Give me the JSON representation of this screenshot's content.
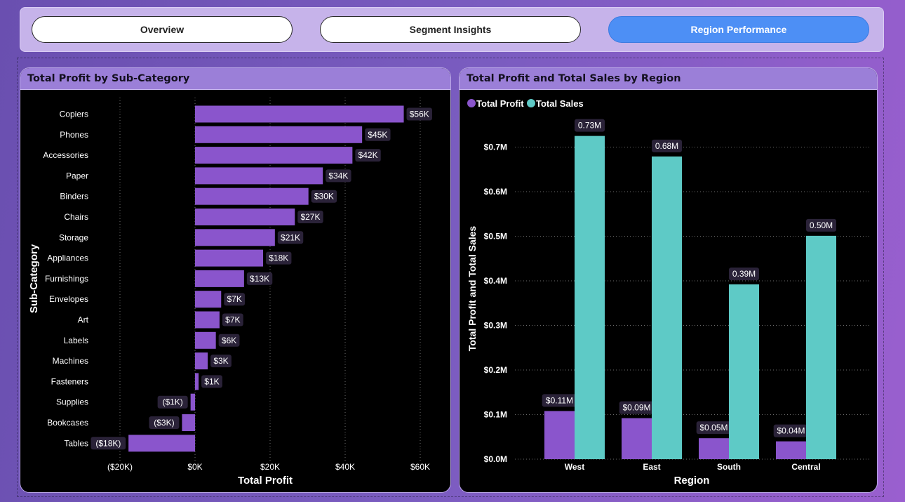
{
  "nav": {
    "tabs": [
      {
        "label": "Overview",
        "active": false
      },
      {
        "label": "Segment Insights",
        "active": false
      },
      {
        "label": "Region Performance",
        "active": true
      }
    ]
  },
  "left_panel": {
    "title": "Total Profit by Sub-Category"
  },
  "right_panel": {
    "title": "Total Profit and Total Sales by Region"
  },
  "colors": {
    "profit": "#8a55cc",
    "sales": "#5ecac6",
    "label_bg": "#2a2238"
  },
  "chart_data": [
    {
      "type": "bar",
      "orientation": "horizontal",
      "title": "Total Profit by Sub-Category",
      "xlabel": "Total Profit",
      "ylabel": "Sub-Category",
      "xlim": [
        -20000,
        60000
      ],
      "x_ticks": [
        {
          "value": -20000,
          "label": "($20K)"
        },
        {
          "value": 0,
          "label": "$0K"
        },
        {
          "value": 20000,
          "label": "$20K"
        },
        {
          "value": 40000,
          "label": "$40K"
        },
        {
          "value": 60000,
          "label": "$60K"
        }
      ],
      "grid": true,
      "categories": [
        "Copiers",
        "Phones",
        "Accessories",
        "Paper",
        "Binders",
        "Chairs",
        "Storage",
        "Appliances",
        "Furnishings",
        "Envelopes",
        "Art",
        "Labels",
        "Machines",
        "Fasteners",
        "Supplies",
        "Bookcases",
        "Tables"
      ],
      "values": [
        55618,
        44516,
        41937,
        34054,
        30222,
        26590,
        21279,
        18138,
        13059,
        6964,
        6528,
        5546,
        3385,
        950,
        -1189,
        -3473,
        -17725
      ],
      "data_labels": [
        "$56K",
        "$45K",
        "$42K",
        "$34K",
        "$30K",
        "$27K",
        "$21K",
        "$18K",
        "$13K",
        "$7K",
        "$7K",
        "$6K",
        "$3K",
        "$1K",
        "($1K)",
        "($3K)",
        "($18K)"
      ]
    },
    {
      "type": "bar",
      "title": "Total Profit and Total Sales by Region",
      "xlabel": "Region",
      "ylabel": "Total Profit and Total Sales",
      "ylim": [
        0,
        0.75
      ],
      "y_ticks": [
        {
          "value": 0.0,
          "label": "$0.0M"
        },
        {
          "value": 0.1,
          "label": "$0.1M"
        },
        {
          "value": 0.2,
          "label": "$0.2M"
        },
        {
          "value": 0.3,
          "label": "$0.3M"
        },
        {
          "value": 0.4,
          "label": "$0.4M"
        },
        {
          "value": 0.5,
          "label": "$0.5M"
        },
        {
          "value": 0.6,
          "label": "$0.6M"
        },
        {
          "value": 0.7,
          "label": "$0.7M"
        }
      ],
      "grid": true,
      "legend": "top-left",
      "categories": [
        "West",
        "East",
        "South",
        "Central"
      ],
      "series": [
        {
          "name": "Total Profit",
          "values": [
            0.108,
            0.092,
            0.047,
            0.04
          ],
          "labels": [
            "$0.11M",
            "$0.09M",
            "$0.05M",
            "$0.04M"
          ]
        },
        {
          "name": "Total Sales",
          "values": [
            0.725,
            0.679,
            0.392,
            0.501
          ],
          "labels": [
            "0.73M",
            "0.68M",
            "0.39M",
            "0.50M"
          ]
        }
      ]
    }
  ]
}
